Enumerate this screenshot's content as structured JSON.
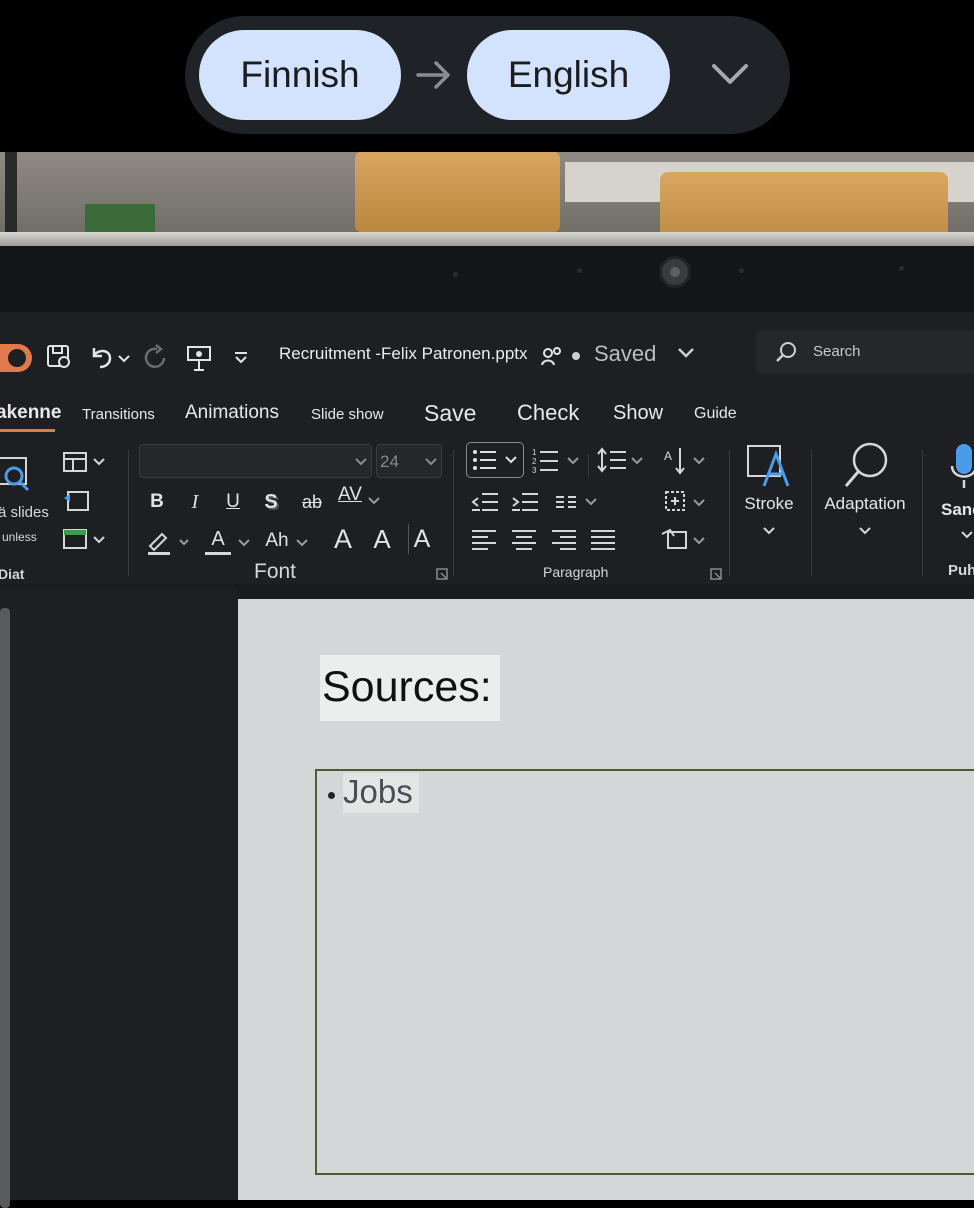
{
  "translate_bar": {
    "source_language": "Finnish",
    "target_language": "English"
  },
  "titlebar": {
    "file_name": "Recruitment -Felix Patronen.pptx",
    "status": "Saved",
    "search_placeholder": "Search"
  },
  "tabs": [
    "akenne",
    "Transitions",
    "Animations",
    "Slide show",
    "Save",
    "Check",
    "Show",
    "Guide"
  ],
  "ribbon": {
    "slides_group": {
      "new_slide_label": "ä slides",
      "reuse_label": "unless",
      "group_label": "Diat"
    },
    "font_group": {
      "font_name": "",
      "font_size": "24",
      "group_label": "Font",
      "bold": "B",
      "italic": "I",
      "underline": "U",
      "shadow": "S",
      "strike": "ab",
      "spacing": "AV",
      "change_case": "Ah",
      "grow": "A",
      "shrink": "A",
      "clear": "A"
    },
    "paragraph_group": {
      "group_label": "Paragraph"
    },
    "stroke_label": "Stroke",
    "adaptation_label": "Adaptation",
    "dictate_label": "Sanc",
    "dictate_group_label": "Puh"
  },
  "slide": {
    "title": "Sources:",
    "bullets": [
      "Jobs"
    ]
  },
  "colors": {
    "pill": "#d3e3fd",
    "accent": "#e07a4c",
    "dictate_icon": "#4a9be8"
  }
}
